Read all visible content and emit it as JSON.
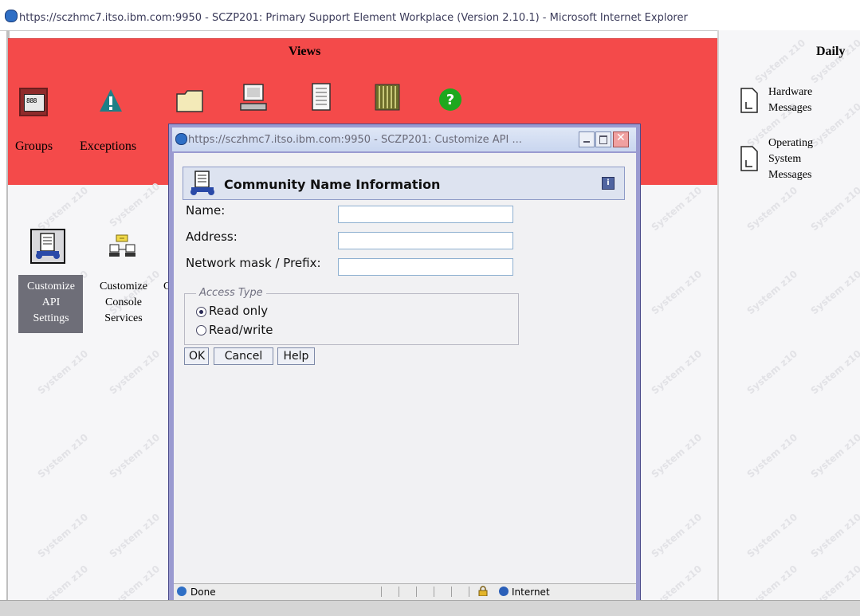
{
  "browser": {
    "title": "https://sczhmc7.itso.ibm.com:9950 - SCZP201: Primary Support Element Workplace (Version 2.10.1) - Microsoft Internet Explorer"
  },
  "views": {
    "title": "Views",
    "items": [
      {
        "label": "Groups",
        "icon": "groups-icon"
      },
      {
        "label": "Exceptions",
        "icon": "exceptions-warning-icon"
      },
      {
        "label": "",
        "icon": "folder-icon"
      },
      {
        "label": "",
        "icon": "computer-icon"
      },
      {
        "label": "",
        "icon": "document-list-icon"
      },
      {
        "label": "",
        "icon": "books-icon"
      },
      {
        "label": "",
        "icon": "help-icon"
      }
    ]
  },
  "tasks": [
    {
      "lines": [
        "Customize",
        "API",
        "Settings"
      ],
      "selected": true
    },
    {
      "lines": [
        "Customize",
        "Console",
        "Services"
      ],
      "selected": false
    },
    {
      "lines": [
        "C"
      ],
      "selected": false
    }
  ],
  "daily": {
    "title": "Daily",
    "items": [
      {
        "lines": [
          "Hardware",
          "Messages"
        ]
      },
      {
        "lines": [
          "Operating",
          "System",
          "Messages"
        ]
      }
    ]
  },
  "watermark": "System z10",
  "dialog": {
    "title": "https://sczhmc7.itso.ibm.com:9950 - SCZP201: Customize API ...",
    "header": "Community Name Information",
    "fields": [
      {
        "label": "Name:",
        "value": ""
      },
      {
        "label": "Address:",
        "value": ""
      },
      {
        "label": "Network mask / Prefix:",
        "value": ""
      }
    ],
    "access_type": {
      "legend": "Access Type",
      "options": [
        {
          "label": "Read only",
          "selected": true
        },
        {
          "label": "Read/write",
          "selected": false
        }
      ]
    },
    "buttons": {
      "ok": "OK",
      "cancel": "Cancel",
      "help": "Help"
    },
    "status": {
      "left": "Done",
      "zone": "Internet"
    }
  },
  "colors": {
    "views_bg": "#f44a4a",
    "dialog_frame": "#9a9ad0",
    "selected_task": "#6e6e78"
  }
}
